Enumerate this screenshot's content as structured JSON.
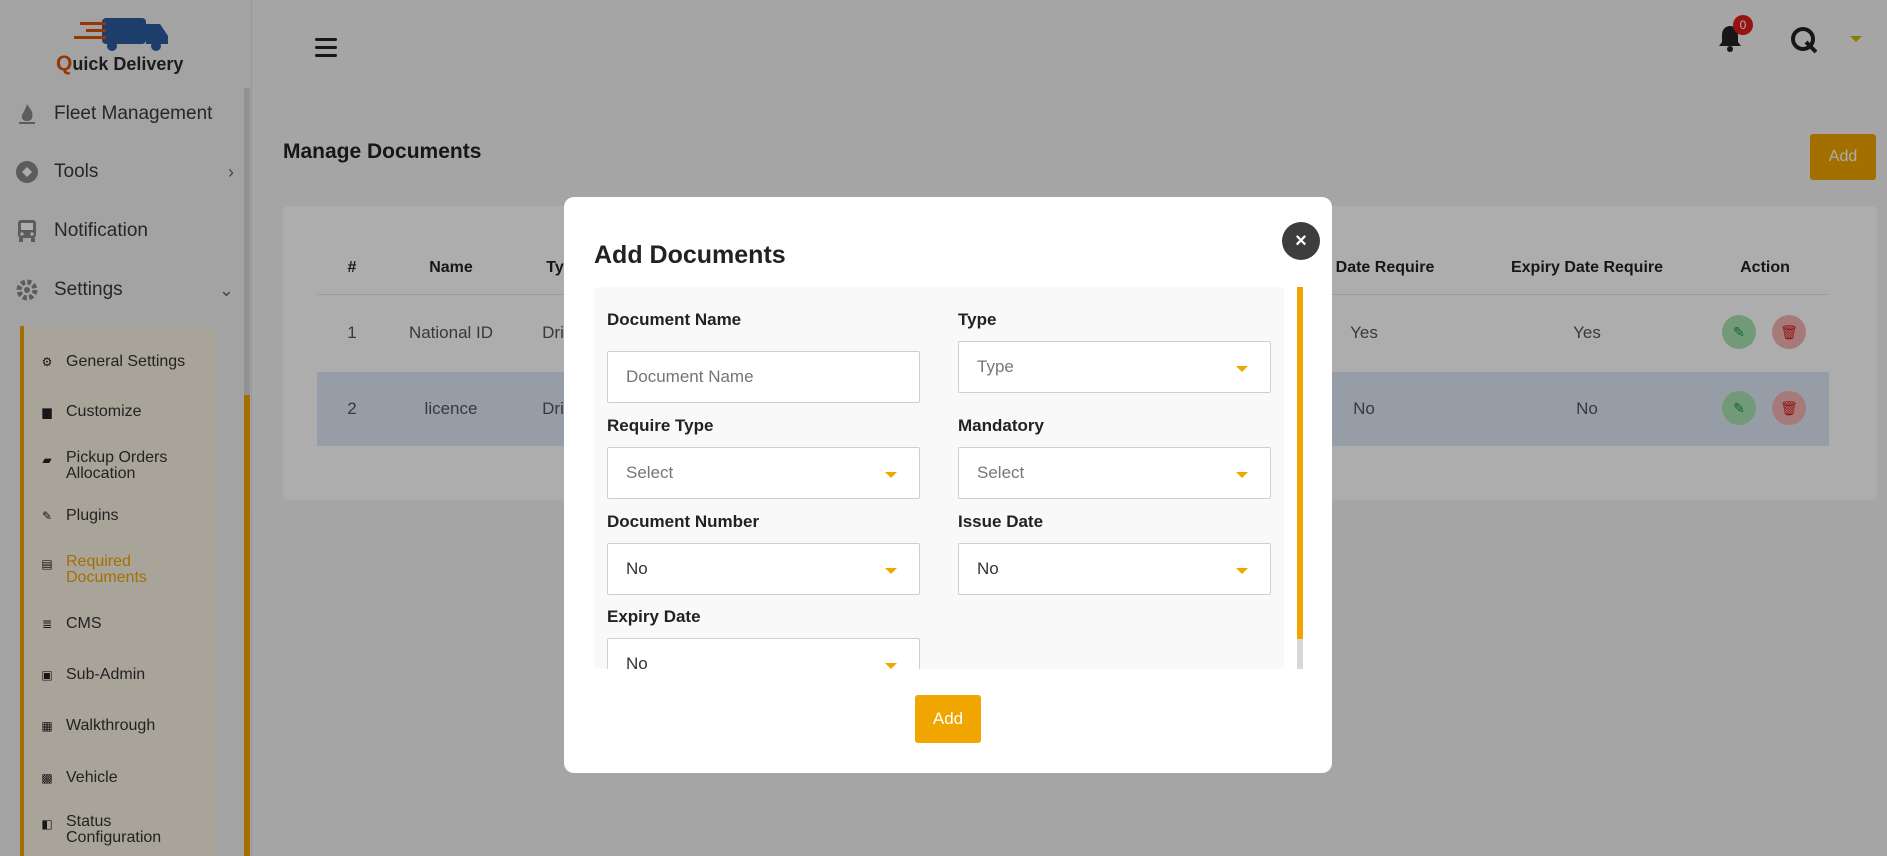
{
  "brand": {
    "q": "Q",
    "rest": "uick Delivery"
  },
  "sidebar": {
    "items": [
      {
        "label": "Fleet Management"
      },
      {
        "label": "Tools"
      },
      {
        "label": "Notification"
      },
      {
        "label": "Settings"
      }
    ],
    "submenu": [
      {
        "label": "General Settings"
      },
      {
        "label": "Customize"
      },
      {
        "label": "Pickup Orders Allocation"
      },
      {
        "label": "Plugins"
      },
      {
        "label": "Required Documents"
      },
      {
        "label": "CMS"
      },
      {
        "label": "Sub-Admin"
      },
      {
        "label": "Walkthrough"
      },
      {
        "label": "Vehicle"
      },
      {
        "label": "Status Configuration"
      }
    ]
  },
  "header": {
    "notification_count": "0"
  },
  "page": {
    "title": "Manage Documents",
    "add_label": "Add"
  },
  "table": {
    "headers": [
      "#",
      "Name",
      "Ty",
      "Date Require",
      "Expiry Date Require",
      "Action"
    ],
    "rows": [
      {
        "num": "1",
        "name": "National ID",
        "type": "Dri",
        "date_require": "Yes",
        "expiry_require": "Yes"
      },
      {
        "num": "2",
        "name": "licence",
        "type": "Dri",
        "date_require": "No",
        "expiry_require": "No"
      }
    ]
  },
  "modal": {
    "title": "Add Documents",
    "close": "×",
    "fields": {
      "document_name": {
        "label": "Document Name",
        "placeholder": "Document Name"
      },
      "type": {
        "label": "Type",
        "value": "Type"
      },
      "require_type": {
        "label": "Require Type",
        "value": "Select"
      },
      "mandatory": {
        "label": "Mandatory",
        "value": "Select"
      },
      "document_number": {
        "label": "Document Number",
        "value": "No"
      },
      "issue_date": {
        "label": "Issue Date",
        "value": "No"
      },
      "expiry_date": {
        "label": "Expiry Date",
        "value": "No"
      }
    },
    "submit_label": "Add"
  },
  "colors": {
    "accent": "#f0a500",
    "danger": "#e01b1b",
    "success": "#1f8f35"
  }
}
